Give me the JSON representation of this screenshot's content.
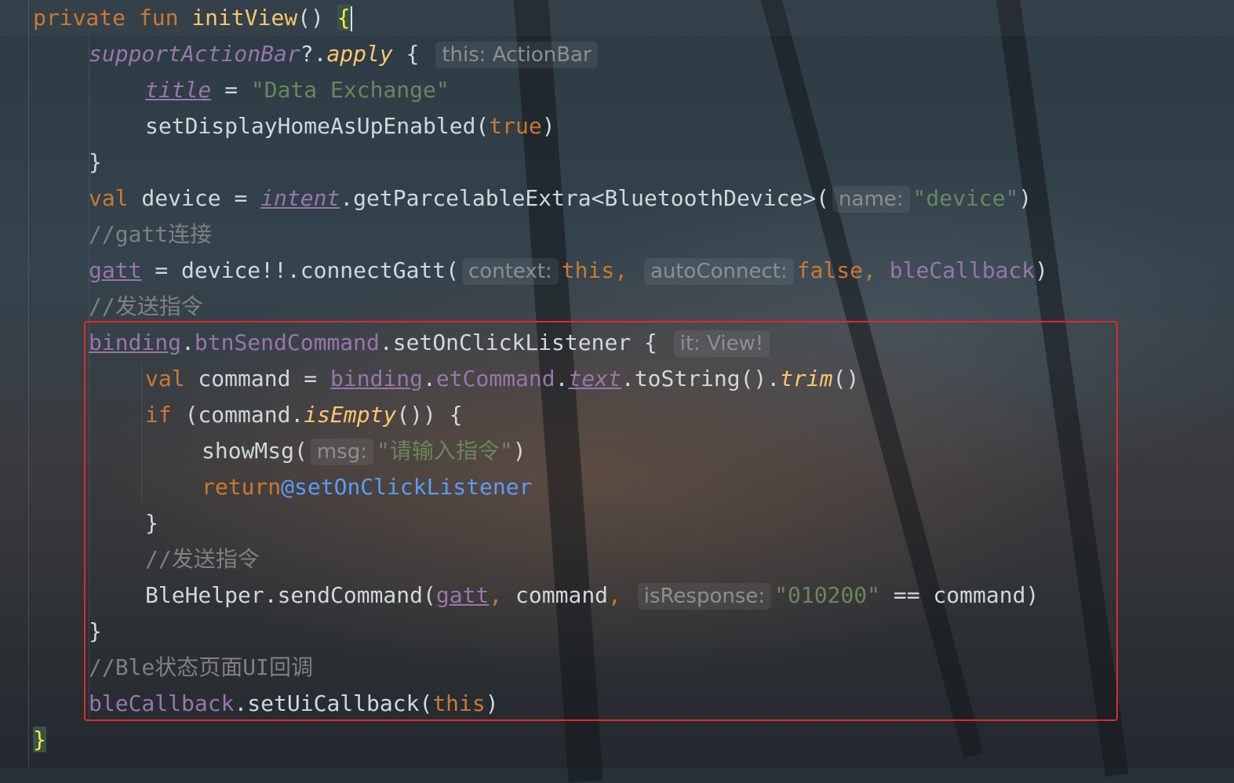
{
  "code": {
    "l1": {
      "kw1": "private",
      "kw2": "fun",
      "name": "initView",
      "paren": "()",
      "brace": "{"
    },
    "l2": {
      "recv": "supportActionBar",
      "op": "?.",
      "ext": "apply",
      "brace": " {",
      "hint": "this: ActionBar"
    },
    "l3": {
      "prop": "title",
      "eq": " = ",
      "str": "\"Data Exchange\""
    },
    "l4": {
      "call": "setDisplayHomeAsUpEnabled(",
      "kw": "true",
      "close": ")"
    },
    "l5": {
      "brace": "}"
    },
    "l6": {
      "kw": "val",
      "name": " device = ",
      "prop": "intent",
      "rest": ".getParcelableExtra<BluetoothDevice>(",
      "hint": "name:",
      "str": "\"device\"",
      "close": ")"
    },
    "l7": {
      "comment": "//gatt连接"
    },
    "l8": {
      "prop": "gatt",
      "mid": " = device!!.connectGatt(",
      "hint1": "context:",
      "kw1": "this,",
      "hint2": "autoConnect:",
      "kw2": "false,",
      "prop2": "bleCallback",
      "close": ")"
    },
    "l9": {
      "comment": "//发送指令"
    },
    "l10": {
      "prop": "binding",
      "dot": ".",
      "prop2": "btnSendCommand",
      "rest": ".setOnClickListener {",
      "hint": "it: View!"
    },
    "l11": {
      "kw": "val",
      "mid": " command = ",
      "prop": "binding",
      "dot": ".",
      "prop2": "etCommand",
      "dot2": ".",
      "prop3": "text",
      "rest": ".toString().",
      "ext": "trim",
      "close": "()"
    },
    "l12": {
      "kw": "if",
      "mid": " (command.",
      "ext": "isEmpty",
      "close": "()) {"
    },
    "l13": {
      "call": "showMsg(",
      "hint": "msg:",
      "str": "\"请输入指令\"",
      "close": ")"
    },
    "l14": {
      "kw": "return",
      "label": "@setOnClickListener"
    },
    "l15": {
      "brace": "}"
    },
    "l16": {
      "comment": "//发送指令"
    },
    "l17": {
      "call": "BleHelper.sendCommand(",
      "prop": "gatt",
      "comma": ",",
      "mid": " command",
      "comma2": ",",
      "hint": "isResponse:",
      "str": "\"010200\"",
      "rest": " == command)"
    },
    "l18": {
      "brace": "}"
    },
    "l19": {
      "comment": "//Ble状态页面UI回调"
    },
    "l20": {
      "prop": "bleCallback",
      "rest": ".setUiCallback(",
      "kw": "this",
      "close": ")"
    },
    "l21": {
      "brace": "}"
    }
  },
  "colors": {
    "keyword": "#cc7832",
    "function": "#ffc66d",
    "string": "#6a8759",
    "comment": "#808080",
    "property": "#9876aa",
    "label": "#589df6",
    "highlight_box": "#e0282a"
  }
}
